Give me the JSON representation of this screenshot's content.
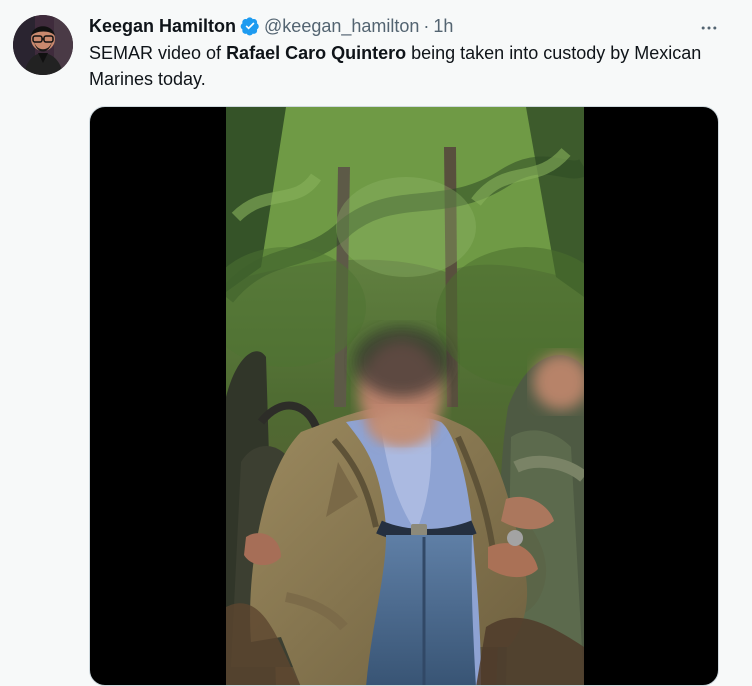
{
  "tweet": {
    "author_name": "Keegan Hamilton",
    "handle": "@keegan_hamilton",
    "separator": "·",
    "time": "1h",
    "text_before": "SEMAR video of ",
    "text_bold": "Rafael Caro Quintero",
    "text_after": " being taken into custody by Mexican Marines today.",
    "more_icon": "more-horizontal-icon",
    "verified_icon": "verified-badge-icon"
  },
  "colors": {
    "background": "#f7f9f9",
    "text": "#0f1419",
    "muted": "#536471",
    "verified": "#1d9bf0",
    "media_background": "#000000"
  }
}
